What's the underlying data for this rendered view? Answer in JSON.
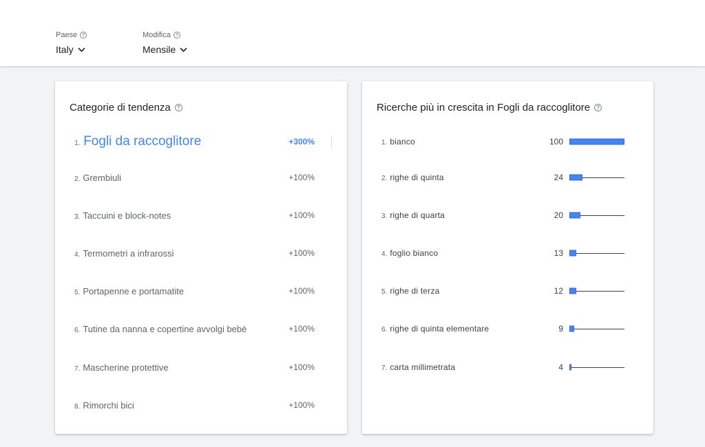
{
  "filters": {
    "country": {
      "label": "Paese",
      "value": "Italy"
    },
    "period": {
      "label": "Modifica",
      "value": "Mensile"
    }
  },
  "left_card": {
    "title": "Categorie di tendenza",
    "items": [
      {
        "rank": "1.",
        "name": "Fogli da raccoglitore",
        "change": "+300%"
      },
      {
        "rank": "2.",
        "name": "Grembiuli",
        "change": "+100%"
      },
      {
        "rank": "3.",
        "name": "Taccuini e block-notes",
        "change": "+100%"
      },
      {
        "rank": "4.",
        "name": "Termometri a infrarossi",
        "change": "+100%"
      },
      {
        "rank": "5.",
        "name": "Portapenne e portamatite",
        "change": "+100%"
      },
      {
        "rank": "6.",
        "name": "Tutine da nanna e copertine avvolgi bebè",
        "change": "+100%"
      },
      {
        "rank": "7.",
        "name": "Mascherine protettive",
        "change": "+100%"
      },
      {
        "rank": "8.",
        "name": "Rimorchi bici",
        "change": "+100%"
      }
    ]
  },
  "right_card": {
    "title": "Ricerche più in crescita in Fogli da raccoglitore",
    "items": [
      {
        "rank": "1.",
        "query": "bianco",
        "value": 100
      },
      {
        "rank": "2.",
        "query": "righe di quinta",
        "value": 24
      },
      {
        "rank": "3.",
        "query": "righe di quarta",
        "value": 20
      },
      {
        "rank": "4.",
        "query": "foglio bianco",
        "value": 13
      },
      {
        "rank": "5.",
        "query": "righe di terza",
        "value": 12
      },
      {
        "rank": "6.",
        "query": "righe di quinta elementare",
        "value": 9
      },
      {
        "rank": "7.",
        "query": "carta millimetrata",
        "value": 4
      }
    ]
  },
  "colors": {
    "accent": "#4285f4",
    "bar": "#4285f4"
  },
  "icons": {
    "help": "help-circle-icon",
    "dropdown": "chevron-down-icon"
  }
}
